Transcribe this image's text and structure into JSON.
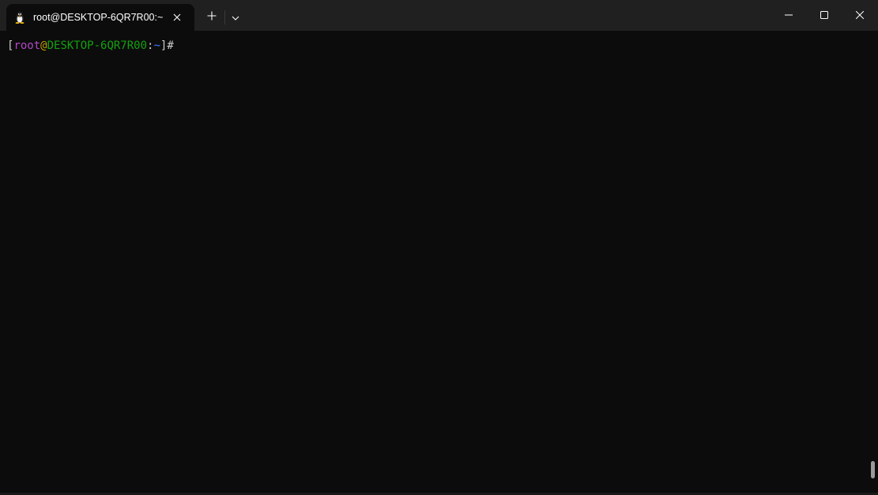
{
  "tab": {
    "title": "root@DESKTOP-6QR7R00:~",
    "icon": "linux-penguin-icon"
  },
  "controls": {
    "new_tab_icon": "plus-icon",
    "dropdown_icon": "chevron-down-icon",
    "minimize_icon": "minimize-icon",
    "maximize_icon": "maximize-icon",
    "close_icon": "close-icon"
  },
  "prompt": {
    "open_bracket": "[",
    "user": "root",
    "at": "@",
    "host": "DESKTOP-6QR7R00",
    "colon": ":",
    "path": "~",
    "close_bracket": "]",
    "symbol": "#"
  },
  "colors": {
    "background": "#0c0c0c",
    "titlebar": "#202020",
    "user": "#b148c6",
    "at": "#c19c00",
    "host": "#13a10e",
    "path": "#3b78ff"
  }
}
